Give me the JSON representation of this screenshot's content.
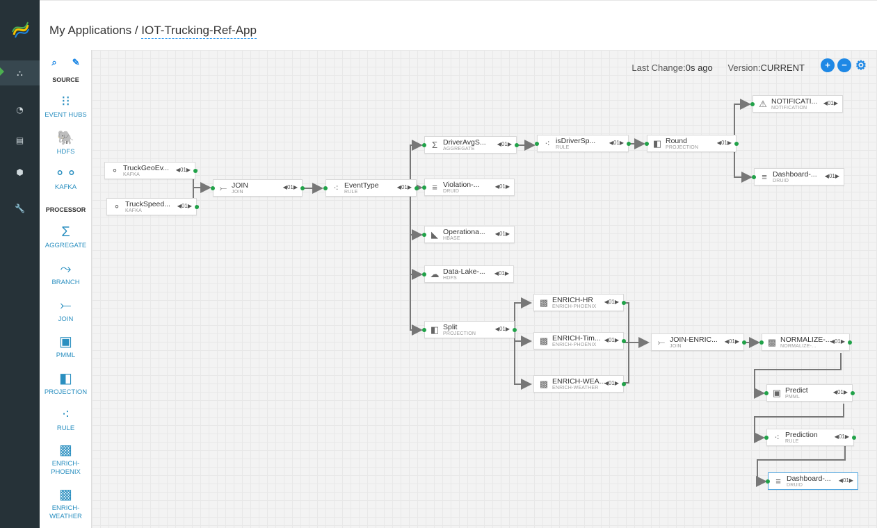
{
  "nav": {
    "items": [
      {
        "name": "topology",
        "glyph": "⛬"
      },
      {
        "name": "dashboard",
        "glyph": "◔"
      },
      {
        "name": "document",
        "glyph": "▤"
      },
      {
        "name": "model",
        "glyph": "⬢"
      },
      {
        "name": "config",
        "glyph": "🔧"
      }
    ]
  },
  "header": {
    "root": "My Applications",
    "separator": " / ",
    "app_name": "IOT-Trucking-Ref-App"
  },
  "status": {
    "last_change_label": "Last Change:",
    "last_change_value": "0s ago",
    "version_label": "Version:",
    "version_value": "CURRENT"
  },
  "toolbox": {
    "source_title": "SOURCE",
    "processor_title": "PROCESSOR",
    "sources": [
      {
        "label": "EVENT HUBS",
        "glyph": "⁝⁝"
      },
      {
        "label": "HDFS",
        "glyph": "🐘"
      },
      {
        "label": "KAFKA",
        "glyph": "⚬⚬"
      }
    ],
    "processors": [
      {
        "label": "AGGREGATE",
        "glyph": "Σ"
      },
      {
        "label": "BRANCH",
        "glyph": "⤳"
      },
      {
        "label": "JOIN",
        "glyph": "⤚"
      },
      {
        "label": "PMML",
        "glyph": "▣"
      },
      {
        "label": "PROJECTION",
        "glyph": "◧"
      },
      {
        "label": "RULE",
        "glyph": "⁖"
      },
      {
        "label": "ENRICH-\nPHOENIX",
        "glyph": "▩"
      },
      {
        "label": "ENRICH-\nWEATHER",
        "glyph": "▩"
      }
    ]
  },
  "parallelism": "01",
  "nodes": [
    {
      "id": "truckgeo",
      "title": "TruckGeoEv...",
      "sub": "KAFKA",
      "glyph": "⚬"
    },
    {
      "id": "truckspeed",
      "title": "TruckSpeed...",
      "sub": "KAFKA",
      "glyph": "⚬"
    },
    {
      "id": "join1",
      "title": "JOIN",
      "sub": "JOIN",
      "glyph": "⤚"
    },
    {
      "id": "eventtype",
      "title": "EventType",
      "sub": "RULE",
      "glyph": "⁖"
    },
    {
      "id": "driveravg",
      "title": "DriverAvgS...",
      "sub": "AGGREGATE",
      "glyph": "Σ"
    },
    {
      "id": "isdriver",
      "title": "isDriverSp...",
      "sub": "RULE",
      "glyph": "⁖"
    },
    {
      "id": "round",
      "title": "Round",
      "sub": "PROJECTION",
      "glyph": "◧"
    },
    {
      "id": "notification",
      "title": "NOTIFICATI...",
      "sub": "NOTIFICATION",
      "glyph": "⚠"
    },
    {
      "id": "dashboard1",
      "title": "Dashboard-...",
      "sub": "DRUID",
      "glyph": "≡"
    },
    {
      "id": "violation",
      "title": "Violation-...",
      "sub": "DRUID",
      "glyph": "≡"
    },
    {
      "id": "operational",
      "title": "Operationa...",
      "sub": "HBASE",
      "glyph": "◣"
    },
    {
      "id": "datalake",
      "title": "Data-Lake-...",
      "sub": "HDFS",
      "glyph": "☁"
    },
    {
      "id": "split",
      "title": "Split",
      "sub": "PROJECTION",
      "glyph": "◧"
    },
    {
      "id": "enrichhr",
      "title": "ENRICH-HR",
      "sub": "ENRICH-PHOENIX",
      "glyph": "▩"
    },
    {
      "id": "enrichtim",
      "title": "ENRICH-Tim...",
      "sub": "ENRICH-PHOENIX",
      "glyph": "▩"
    },
    {
      "id": "enrichwea",
      "title": "ENRICH-WEA...",
      "sub": "ENRICH-WEATHER",
      "glyph": "▩"
    },
    {
      "id": "joinenrich",
      "title": "JOIN-ENRIC...",
      "sub": "JOIN",
      "glyph": "⤚"
    },
    {
      "id": "normalize",
      "title": "NORMALIZE-...",
      "sub": "NORMALIZE-...",
      "glyph": "▩"
    },
    {
      "id": "predict",
      "title": "Predict",
      "sub": "PMML",
      "glyph": "▣"
    },
    {
      "id": "prediction",
      "title": "Prediction",
      "sub": "RULE",
      "glyph": "⁖"
    },
    {
      "id": "dashboard2",
      "title": "Dashboard-...",
      "sub": "DRUID",
      "glyph": "≡"
    }
  ]
}
